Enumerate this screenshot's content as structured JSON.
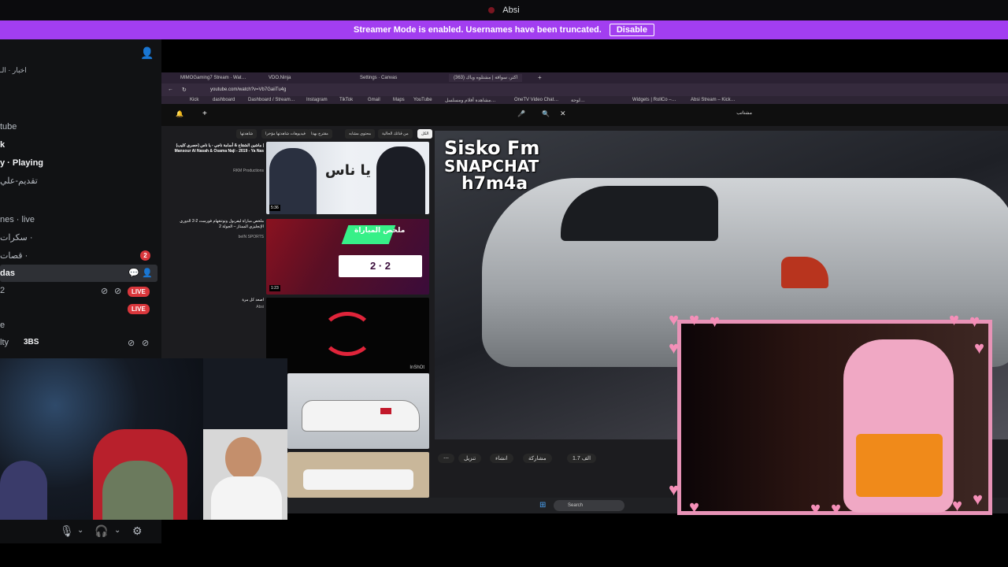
{
  "titlebar": {
    "title": "Absi"
  },
  "banner": {
    "message": "Streamer Mode is enabled. Usernames have been truncated.",
    "button_label": "Disable"
  },
  "sidebar": {
    "rows": [
      {
        "text": "اخبار · الـ"
      },
      {
        "text": "tube"
      },
      {
        "text": "k"
      },
      {
        "text": "y · Playing"
      },
      {
        "text": "تقديم-علي"
      },
      {
        "text": "nes · live"
      },
      {
        "text": "سكرات ·"
      },
      {
        "text": "قصات ·"
      },
      {
        "text": "das"
      },
      {
        "text": "2"
      },
      {
        "text": "e"
      },
      {
        "text": "lty"
      }
    ],
    "mention_count": "2",
    "live_label": "LIVE",
    "community_count": "3BS"
  },
  "browser": {
    "tabs": [
      "MIMOGaming7 Stream · Wat…",
      "VDO.Ninja",
      "Settings · Canvas",
      "(363) اكثر، سواقة | مشتلوه وياك"
    ],
    "url": "youtube.com/watch?v=Vb7GaiiTu4g",
    "bookmarks": [
      "Kick",
      "dashboard",
      "Dashboard / Stream…",
      "Instagram",
      "TikTok",
      "Gmail",
      "Maps",
      "YouTube",
      "مشاهدة أفلام ومسلسل…",
      "OneTV Video Chat…",
      "لوحة…",
      "Widgets | RollCo –…",
      "Absi Stream – Kick…"
    ],
    "search_placeholder": "مشتاتب"
  },
  "youtube": {
    "chips": [
      "الكل",
      "من قناتك الحالية",
      "محتوى مشابه",
      "مقترح بهذا",
      "فيديوهات شاهدتها مؤخرا",
      "شاهدتها"
    ],
    "up_next": [
      {
        "title": "ماشين الشقاح & أسامة ناجي - يا ناس (حصري كليب) | Mansour Al Nasah & Osama Naji - 2019 - Ya Nas",
        "meta": "RKM Productions",
        "duration": "5:36",
        "thumb_text": "يا ناس"
      },
      {
        "title": "ملخص مباراة ليفربول ونوتنغهام فورست 2-2 الدوري الإنجليزي الممتاز – الجولة 2",
        "meta": "beIN SPORTS",
        "duration": "1:23",
        "thumb_text": "ملخص المباراة",
        "score": "2 · 2"
      },
      {
        "title": "اصعد كل مرة",
        "meta": "Absi",
        "duration": "",
        "thumb_text": "InShOt"
      }
    ],
    "watermark": [
      "Sisko Fm",
      "SNAPCHAT",
      "h7m4a"
    ],
    "actions": [
      "1.7 الف",
      "مشاركة",
      "انشاء",
      "تنزيل"
    ]
  },
  "taskbar": {
    "search": "Search"
  },
  "colors": {
    "accent": "#a23ef0",
    "live": "#da373c",
    "overlay_frame": "#e893b7"
  }
}
